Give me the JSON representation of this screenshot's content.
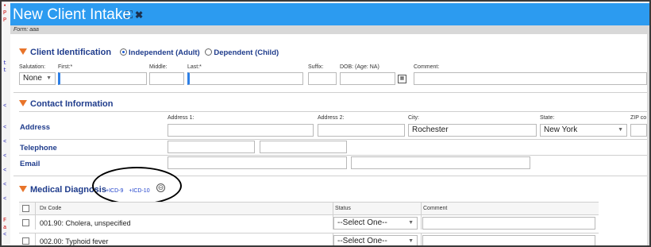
{
  "window": {
    "title": "New Client Intake",
    "form_label": "Form: aaa"
  },
  "gutter": [
    "•",
    "P",
    "P",
    "",
    "",
    "",
    "",
    "",
    "t",
    "t",
    "",
    "",
    "",
    "<",
    "",
    "",
    "",
    "<",
    "",
    "<",
    "",
    "<",
    "",
    "<",
    "",
    "<",
    "",
    "<",
    "",
    "",
    "",
    "F",
    "a",
    "a",
    "<",
    ""
  ],
  "client_identification": {
    "title": "Client Identification",
    "radio_independent": "Independent (Adult)",
    "radio_dependent": "Dependent (Child)",
    "salutation_label": "Salutation:",
    "salutation_value": "None",
    "first_label": "First:*",
    "middle_label": "Middle:",
    "last_label": "Last:*",
    "suffix_label": "Suffix:",
    "dob_label": "DOB: (Age: NA)",
    "comment_label": "Comment:"
  },
  "contact_information": {
    "title": "Contact Information",
    "address_label": "Address",
    "telephone_label": "Telephone",
    "email_label": "Email",
    "address1_label": "Address 1:",
    "address2_label": "Address 2:",
    "city_label": "City:",
    "city_value": "Rochester",
    "state_label": "State:",
    "state_value": "New York",
    "zip_label": "ZIP co"
  },
  "medical_diagnosis": {
    "title": "Medical Diagnosis",
    "link_icd9": "+ICD-9",
    "link_icd10": "+ICD-10",
    "minus_icon": "⊖",
    "columns": {
      "code": "Dx Code",
      "status": "Status",
      "comment": "Comment"
    },
    "rows": [
      {
        "code": "001.90: Cholera, unspecified",
        "status": "--Select One--"
      },
      {
        "code": "002.00: Typhoid fever",
        "status": "--Select One--"
      }
    ]
  }
}
